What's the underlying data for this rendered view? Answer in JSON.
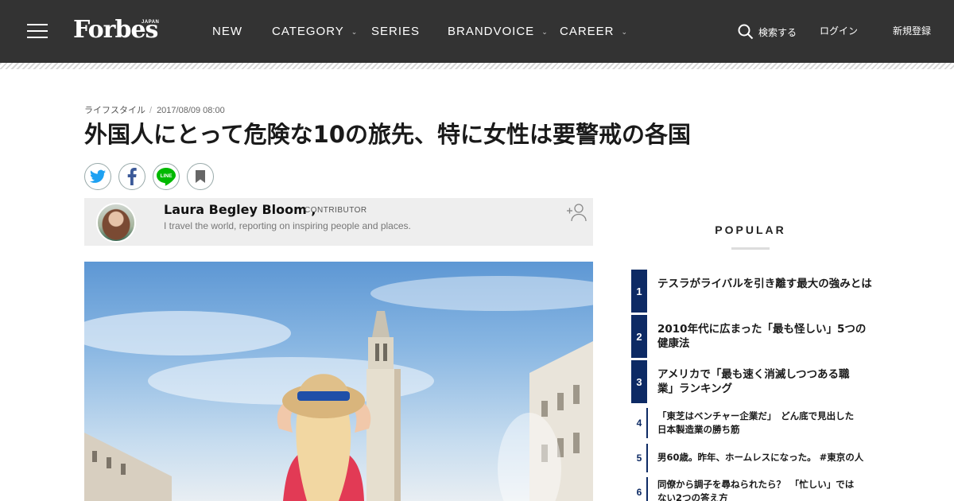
{
  "header": {
    "logo": "Forbes",
    "logo_sub": "JAPAN",
    "nav": [
      {
        "label": "NEW",
        "has_dropdown": false
      },
      {
        "label": "CATEGORY",
        "has_dropdown": true
      },
      {
        "label": "SERIES",
        "has_dropdown": false
      },
      {
        "label": "BRANDVOICE",
        "has_dropdown": true
      },
      {
        "label": "CAREER",
        "has_dropdown": true
      }
    ],
    "search_label": "検索する",
    "login_label": "ログイン",
    "signup_label": "新規登録"
  },
  "article": {
    "category": "ライフスタイル",
    "date": "2017/08/09 08:00",
    "title": "外国人にとって危険な10の旅先、特に女性は要警戒の各国",
    "share_icons": [
      "twitter-icon",
      "facebook-icon",
      "line-icon",
      "bookmark-icon"
    ],
    "line_label": "LINE"
  },
  "author": {
    "name": "Laura Begley Bloom ,",
    "role": "CONTRIBUTOR",
    "bio": "I travel the world, reporting on inspiring people and places."
  },
  "sidebar": {
    "title": "POPULAR",
    "items": [
      {
        "rank": "1",
        "text_lines": [
          "テスラがライバルを引き離す最大の強みとは",
          ""
        ]
      },
      {
        "rank": "2",
        "text_lines": [
          "2010年代に広まった「最も怪しい」5つの",
          "健康法"
        ]
      },
      {
        "rank": "3",
        "text_lines": [
          "アメリカで「最も速く消滅しつつある職",
          "業」ランキング"
        ]
      },
      {
        "rank": "4",
        "text_lines": [
          "「東芝はベンチャー企業だ」　どん底で見出した",
          "日本製造業の勝ち筋"
        ]
      },
      {
        "rank": "5",
        "text_lines": [
          "男60歳。昨年、ホームレスになった。 #東京の人",
          ""
        ]
      },
      {
        "rank": "6",
        "text_lines": [
          "同僚から調子を尋ねられたら？　「忙しい」では",
          "ない2つの答え方"
        ]
      }
    ]
  },
  "colors": {
    "header_bg": "#333333",
    "rank_navy": "#0d2a64",
    "twitter": "#1da1f2",
    "facebook": "#3b5998",
    "line": "#00b900"
  }
}
